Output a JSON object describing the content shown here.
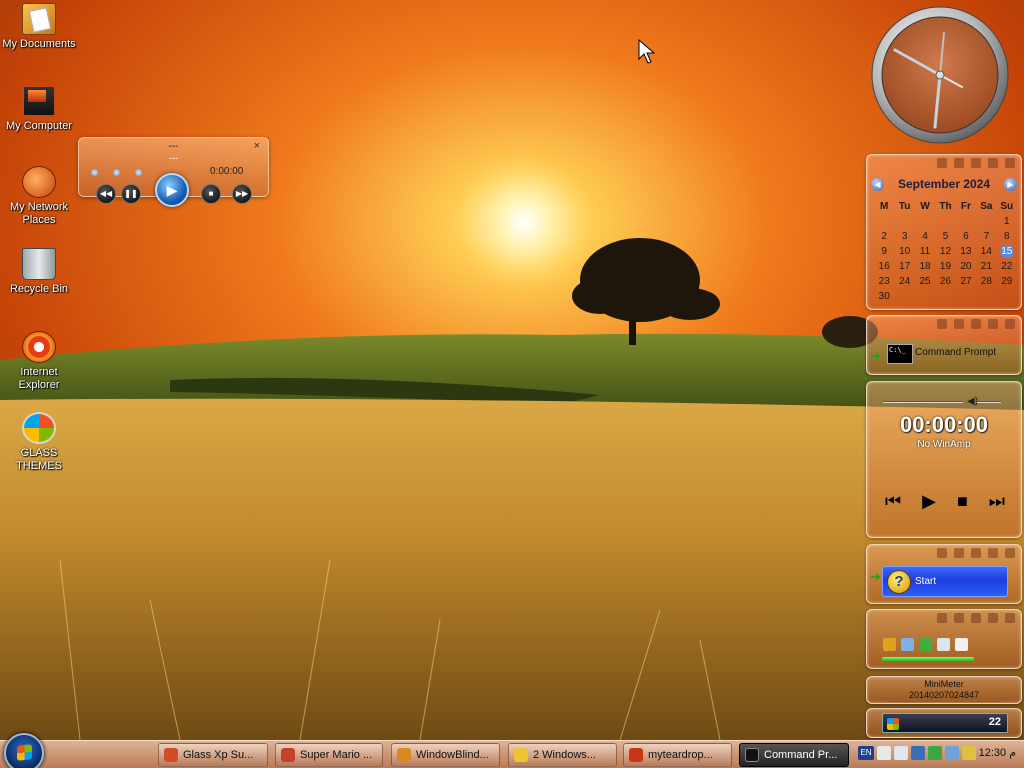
{
  "desktop": {
    "icons": [
      {
        "label": "My Documents",
        "icon": "folder-documents-icon"
      },
      {
        "label": "My Computer",
        "icon": "computer-icon"
      },
      {
        "label": "My Network\nPlaces",
        "icon": "network-places-icon"
      },
      {
        "label": "Recycle Bin",
        "icon": "recycle-bin-icon"
      },
      {
        "label": "Internet\nExplorer",
        "icon": "internet-explorer-icon"
      },
      {
        "label": "GLASS THEMES",
        "icon": "glass-themes-icon"
      }
    ]
  },
  "mini_player": {
    "title": "---",
    "subtitle": "---",
    "close": "×",
    "time": "0:00:00"
  },
  "calendar": {
    "month_title": "September 2024",
    "prev": "◀",
    "next": "▶",
    "weekdays": [
      "M",
      "Tu",
      "W",
      "Th",
      "Fr",
      "Sa",
      "Su"
    ],
    "days": [
      "",
      "",
      "",
      "",
      "",
      "",
      "1",
      "2",
      "3",
      "4",
      "5",
      "6",
      "7",
      "8",
      "9",
      "10",
      "11",
      "12",
      "13",
      "14",
      "15",
      "16",
      "17",
      "18",
      "19",
      "20",
      "21",
      "22",
      "23",
      "24",
      "25",
      "26",
      "27",
      "28",
      "29",
      "30",
      "",
      "",
      "",
      "",
      "",
      ""
    ],
    "today": "15"
  },
  "cmd_gadget": {
    "icon_text": "C:\\_",
    "label": "Command Prompt"
  },
  "winamp": {
    "time": "00:00:00",
    "status": "No WinAmp",
    "controls": [
      "⏮",
      "▶",
      "■",
      "⏭"
    ],
    "volume_icon": "◀)"
  },
  "start_gadget": {
    "label": "Start",
    "icon": "?"
  },
  "minimeter": {
    "title": "MiniMeter",
    "value": "20140207024847"
  },
  "mini_taskbar": {
    "time": "22"
  },
  "taskbar": {
    "buttons": [
      {
        "label": "Glass Xp Su...",
        "icon_color": "#d24b2a"
      },
      {
        "label": "Super Mario ...",
        "icon_color": "#c6402b"
      },
      {
        "label": "WindowBlind...",
        "icon_color": "#d88a1e"
      },
      {
        "label": "2 Windows...",
        "icon_color": "#f0c232"
      },
      {
        "label": "myteardrop...",
        "icon_color": "#c73714"
      },
      {
        "label": "Command Pr...",
        "icon_color": "#101010"
      }
    ],
    "language": "EN",
    "clock": "12:30 م"
  },
  "colors": {
    "gadget_border": "#ffe1cd",
    "taskbar_active": "#222222",
    "accent_blue": "#1e3ee0"
  }
}
